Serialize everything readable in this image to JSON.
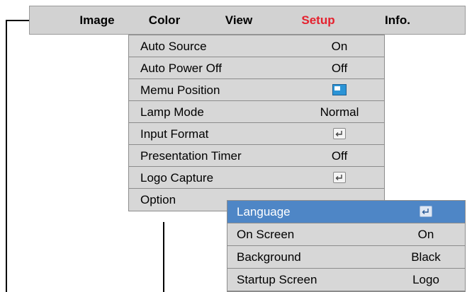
{
  "menubar": {
    "tabs": [
      {
        "label": "Image"
      },
      {
        "label": "Color"
      },
      {
        "label": "View"
      },
      {
        "label": "Setup"
      },
      {
        "label": "Info."
      }
    ],
    "active_tab": "Setup"
  },
  "setup_menu": {
    "items": [
      {
        "label": "Auto Source",
        "value": "On"
      },
      {
        "label": "Auto Power Off",
        "value": "Off"
      },
      {
        "label": "Memu Position",
        "value": "",
        "icon": "menu-position-icon"
      },
      {
        "label": "Lamp Mode",
        "value": "Normal"
      },
      {
        "label": "Input Format",
        "value": "",
        "icon": "enter-icon"
      },
      {
        "label": "Presentation Timer",
        "value": "Off"
      },
      {
        "label": "Logo Capture",
        "value": "",
        "icon": "enter-icon"
      },
      {
        "label": "Option",
        "value": ""
      }
    ]
  },
  "option_menu": {
    "items": [
      {
        "label": "Language",
        "value": "",
        "icon": "enter-icon",
        "selected": true
      },
      {
        "label": "On Screen",
        "value": "On"
      },
      {
        "label": "Background",
        "value": "Black"
      },
      {
        "label": "Startup Screen",
        "value": "Logo"
      }
    ]
  },
  "colors": {
    "active_tab": "#e5212e",
    "highlight": "#4e86c6",
    "menu_bg": "#d7d7d7"
  }
}
